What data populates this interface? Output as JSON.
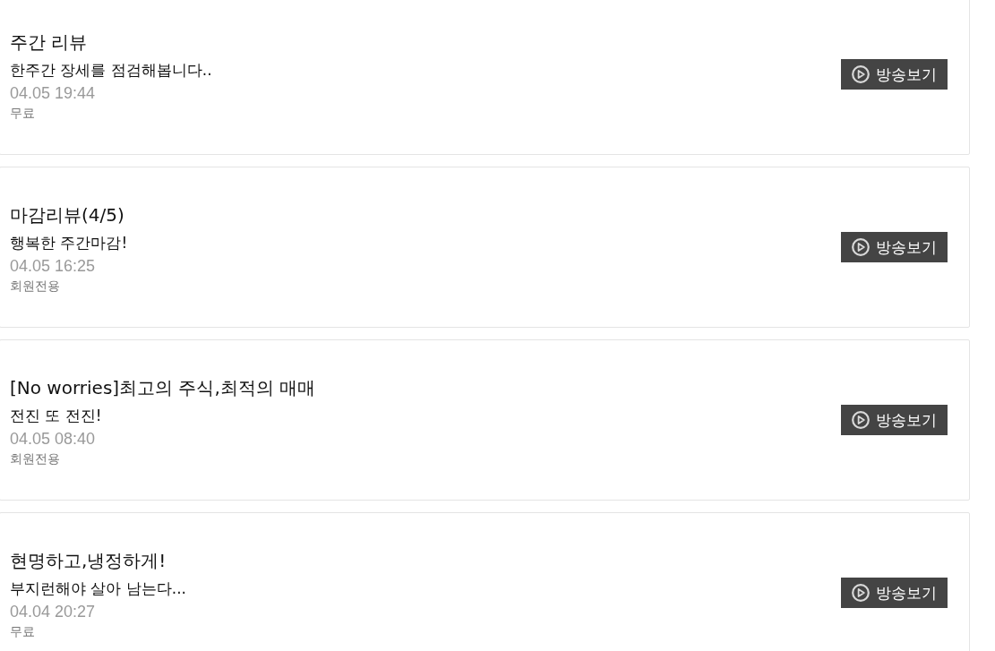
{
  "broadcasts": [
    {
      "title": "주간 리뷰",
      "subtitle": "한주간 장세를 점검해봅니다..",
      "datetime": "04.05 19:44",
      "access": "무료",
      "button": "방송보기"
    },
    {
      "title": "마감리뷰(4/5)",
      "subtitle": "행복한 주간마감!",
      "datetime": "04.05 16:25",
      "access": "회원전용",
      "button": "방송보기"
    },
    {
      "title": "[No worries]최고의 주식,최적의 매매",
      "subtitle": "전진 또 전진!",
      "datetime": "04.05 08:40",
      "access": "회원전용",
      "button": "방송보기"
    },
    {
      "title": "현명하고,냉정하게!",
      "subtitle": "부지런해야 살아 남는다...",
      "datetime": "04.04 20:27",
      "access": "무료",
      "button": "방송보기"
    }
  ]
}
